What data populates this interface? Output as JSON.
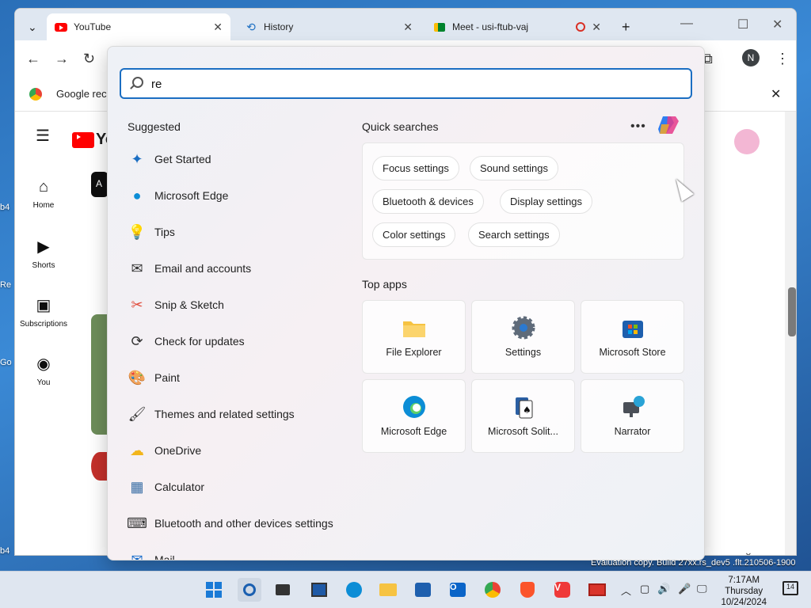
{
  "desktop": {
    "fragments": [
      "b4",
      "Re",
      "Go",
      "b4"
    ]
  },
  "browser": {
    "tabs": [
      {
        "label": "YouTube",
        "icon": "youtube-icon",
        "active": true
      },
      {
        "label": "History",
        "icon": "history-icon",
        "active": false
      },
      {
        "label": "Meet - usi-ftub-vaj",
        "icon": "meet-icon",
        "active": false
      }
    ],
    "new_tab": "+",
    "infobar_text": "Google reco",
    "profile_initial": "N"
  },
  "youtube": {
    "logo_text": "You",
    "sidebar": [
      {
        "label": "Home",
        "icon": "home-icon"
      },
      {
        "label": "Shorts",
        "icon": "shorts-icon"
      },
      {
        "label": "Subscriptions",
        "icon": "subscriptions-icon"
      },
      {
        "label": "You",
        "icon": "you-icon"
      }
    ],
    "chip_fragment": "A"
  },
  "start_menu": {
    "search_value": "re",
    "suggested_title": "Suggested",
    "suggested": [
      {
        "label": "Get Started",
        "icon": "get-started-icon",
        "color": "#1b6ec2"
      },
      {
        "label": "Microsoft Edge",
        "icon": "edge-icon",
        "color": "#0c8dd6"
      },
      {
        "label": "Tips",
        "icon": "tips-icon",
        "color": "#2a7fd4"
      },
      {
        "label": "Email and accounts",
        "icon": "mail-outline-icon",
        "color": "#333333"
      },
      {
        "label": "Snip & Sketch",
        "icon": "snip-sketch-icon",
        "color": "#e04a3a"
      },
      {
        "label": "Check for updates",
        "icon": "sync-icon",
        "color": "#333333"
      },
      {
        "label": "Paint",
        "icon": "paint-icon",
        "color": "#3a8fd8"
      },
      {
        "label": "Themes and related settings",
        "icon": "brush-icon",
        "color": "#333333"
      },
      {
        "label": "OneDrive",
        "icon": "onedrive-icon",
        "color": "#f2b51b"
      },
      {
        "label": "Calculator",
        "icon": "calculator-icon",
        "color": "#3a6ea5"
      },
      {
        "label": "Bluetooth and other devices settings",
        "icon": "devices-icon",
        "color": "#333333"
      },
      {
        "label": "Mail",
        "icon": "mail-icon",
        "color": "#0a64c8"
      }
    ],
    "quick_title": "Quick searches",
    "quick_searches": [
      [
        "Focus settings",
        "Sound settings"
      ],
      [
        "Bluetooth & devices",
        "Display settings"
      ],
      [
        "Color settings",
        "Search settings"
      ]
    ],
    "top_apps_title": "Top apps",
    "top_apps": [
      {
        "label": "File Explorer",
        "icon": "folder-icon"
      },
      {
        "label": "Settings",
        "icon": "settings-gear-icon"
      },
      {
        "label": "Microsoft Store",
        "icon": "store-icon"
      },
      {
        "label": "Microsoft Edge",
        "icon": "edge-icon"
      },
      {
        "label": "Microsoft Solit...",
        "icon": "solitaire-icon"
      },
      {
        "label": "Narrator",
        "icon": "narrator-icon"
      }
    ]
  },
  "taskbar": {
    "eval_text": "Evaluation copy. Build 27xx.rs_dev5 .flt.210506-1900",
    "time": "7:17AM",
    "day": "Thursday",
    "date": "10/24/2024",
    "notification_count": "14"
  },
  "colors": {
    "accent": "#1b6ec2",
    "youtube_red": "#ff0000"
  }
}
